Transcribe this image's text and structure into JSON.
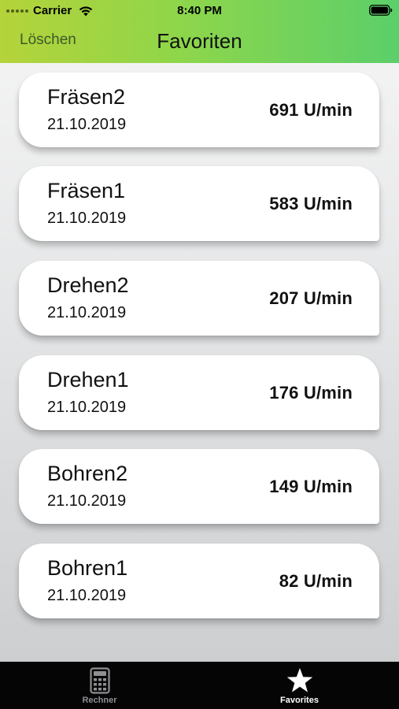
{
  "status_bar": {
    "carrier": "Carrier",
    "time": "8:40 PM"
  },
  "nav": {
    "delete_label": "Löschen",
    "title": "Favoriten"
  },
  "favorites": [
    {
      "name": "Fräsen2",
      "date": "21.10.2019",
      "rpm": "691 U/min"
    },
    {
      "name": "Fräsen1",
      "date": "21.10.2019",
      "rpm": "583 U/min"
    },
    {
      "name": "Drehen2",
      "date": "21.10.2019",
      "rpm": "207 U/min"
    },
    {
      "name": "Drehen1",
      "date": "21.10.2019",
      "rpm": "176 U/min"
    },
    {
      "name": "Bohren2",
      "date": "21.10.2019",
      "rpm": "149 U/min"
    },
    {
      "name": "Bohren1",
      "date": "21.10.2019",
      "rpm": "82 U/min"
    }
  ],
  "tabs": [
    {
      "label": "Rechner",
      "icon": "calculator-icon",
      "selected": false
    },
    {
      "label": "Favorites",
      "icon": "star-icon",
      "selected": true
    }
  ],
  "colors": {
    "header_gradient_start": "#b5d33a",
    "header_gradient_end": "#5bcf6a",
    "delete_text": "#3a5a2a",
    "tab_bar_bg": "#050505",
    "tab_selected": "#ffffff",
    "tab_unselected": "#8e8e93"
  }
}
